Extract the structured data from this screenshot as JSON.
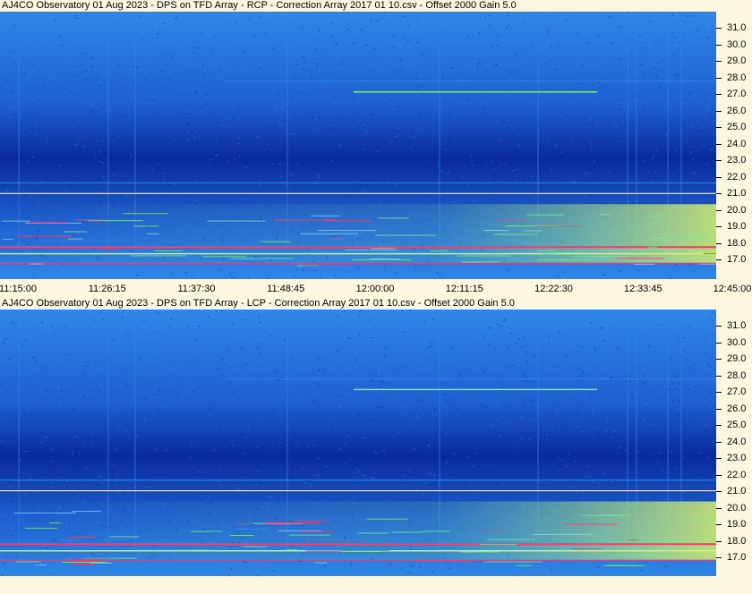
{
  "panels": [
    {
      "title": "AJ4CO Observatory 01 Aug 2023  -  DPS on TFD Array  -  RCP  -  Correction Array 2017 01 10.csv  -  Offset 2000  Gain 5.0",
      "y_ticks": [
        "31.0",
        "30.0",
        "29.0",
        "28.0",
        "27.0",
        "26.0",
        "25.0",
        "24.0",
        "23.0",
        "22.0",
        "21.0",
        "20.0",
        "19.0",
        "18.0",
        "17.0"
      ]
    },
    {
      "title": "AJ4CO Observatory 01 Aug 2023  -  DPS on TFD Array  -  LCP  -  Correction Array 2017 01 10.csv  -  Offset 2000  Gain 5.0",
      "y_ticks": [
        "31.0",
        "30.0",
        "29.0",
        "28.0",
        "27.0",
        "26.0",
        "25.0",
        "24.0",
        "23.0",
        "22.0",
        "21.0",
        "20.0",
        "19.0",
        "18.0",
        "17.0"
      ]
    }
  ],
  "x_ticks": [
    "11:15:00",
    "11:26:15",
    "11:37:30",
    "11:48:45",
    "12:00:00",
    "12:11:15",
    "12:22:30",
    "12:33:45",
    "12:45:00"
  ],
  "colors": {
    "background": "#fdf7e0",
    "spectro_dark": "#0a2a9a",
    "spectro_mid": "#1e5fd0",
    "spectro_light": "#2f86e6",
    "emission_green": "#7de89a",
    "emission_yellow": "#d8f06a",
    "interference_red": "#ff3a6a"
  }
}
